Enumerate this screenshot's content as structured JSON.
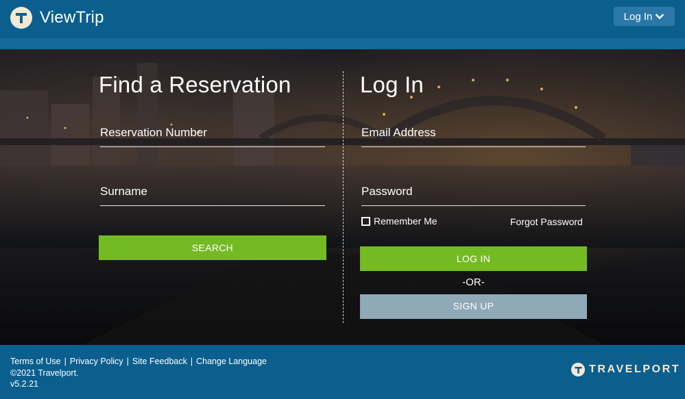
{
  "header": {
    "app_name": "ViewTrip",
    "login_menu_label": "Log In"
  },
  "find_reservation": {
    "title": "Find a Reservation",
    "reservation_number_label": "Reservation Number",
    "surname_label": "Surname",
    "search_button": "SEARCH"
  },
  "login": {
    "title": "Log In",
    "email_label": "Email Address",
    "password_label": "Password",
    "remember_me": "Remember Me",
    "forgot_password": "Forgot Password",
    "login_button": "LOG IN",
    "or_text": "-OR-",
    "signup_button": "SIGN UP"
  },
  "footer": {
    "links": [
      "Terms of Use",
      "Privacy Policy",
      "Site Feedback",
      "Change Language"
    ],
    "copyright": "©2021 Travelport.",
    "version": "v5.2.21",
    "brand": "TRAVELPORT"
  },
  "colors": {
    "header_bg": "#0b5f8e",
    "button_green": "#74bb23",
    "button_grey": "#8fa9b8",
    "logo_circle": "#f6e9d3"
  },
  "icons": [
    "viewtrip-logo-icon",
    "chevron-down-icon",
    "checkbox-icon",
    "travelport-logo-icon"
  ]
}
